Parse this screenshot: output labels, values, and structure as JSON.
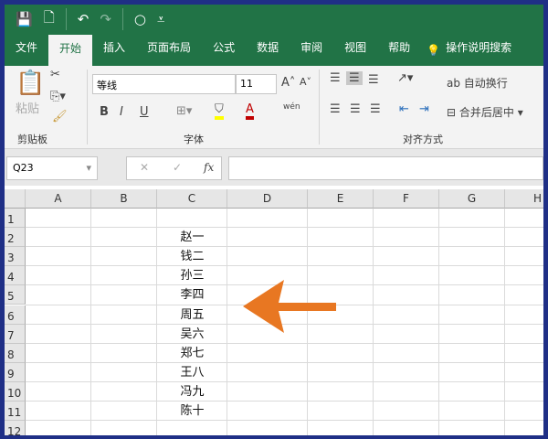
{
  "qat": {
    "save": "💾",
    "new": "🗋",
    "undo": "↶",
    "redo": "↷",
    "circle": "○",
    "more": "⩡"
  },
  "tabs": [
    "文件",
    "开始",
    "插入",
    "页面布局",
    "公式",
    "数据",
    "审阅",
    "视图",
    "帮助"
  ],
  "tell_me": "操作说明搜索",
  "ribbon": {
    "clipboard": {
      "label": "剪贴板",
      "paste": "粘贴"
    },
    "font": {
      "label": "字体",
      "name": "等线",
      "size": "11",
      "bold": "B",
      "italic": "I",
      "underline": "U",
      "phonetic": "wén"
    },
    "alignment": {
      "label": "对齐方式",
      "wrap": "自动换行",
      "merge": "合并后居中"
    }
  },
  "name_box": "Q23",
  "fx": "fx",
  "columns": [
    "A",
    "B",
    "C",
    "D",
    "E",
    "F",
    "G",
    "H"
  ],
  "rows": [
    "1",
    "2",
    "3",
    "4",
    "5",
    "6",
    "7",
    "8",
    "9",
    "10",
    "11",
    "12"
  ],
  "column_c": [
    "",
    "赵一",
    "钱二",
    "孙三",
    "李四",
    "周五",
    "吴六",
    "郑七",
    "王八",
    "冯九",
    "陈十",
    ""
  ],
  "colors": {
    "excel_green": "#217346",
    "arrow": "#e87722",
    "frame": "#1f2f86"
  }
}
